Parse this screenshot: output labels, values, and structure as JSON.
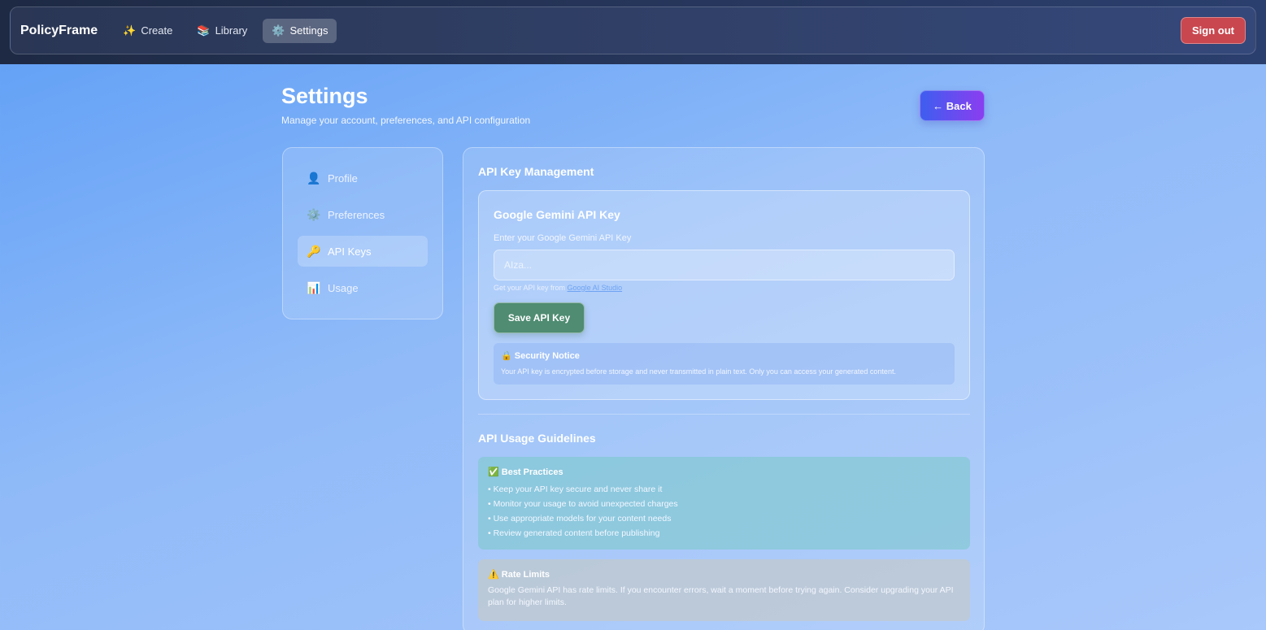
{
  "topbar": {
    "brand": "PolicyFrame",
    "nav": [
      {
        "icon": "✨",
        "icon_name": "sparkles-icon",
        "label": "Create"
      },
      {
        "icon": "📚",
        "icon_name": "books-icon",
        "label": "Library"
      },
      {
        "icon": "⚙️",
        "icon_name": "gear-icon",
        "label": "Settings"
      }
    ],
    "sign_out": "Sign out"
  },
  "header": {
    "title": "Settings",
    "subtitle": "Manage your account, preferences, and API configuration",
    "back_label": "← Back"
  },
  "sidebar": {
    "items": [
      {
        "icon": "👤",
        "icon_name": "user-icon",
        "label": "Profile"
      },
      {
        "icon": "⚙️",
        "icon_name": "gear-icon",
        "label": "Preferences"
      },
      {
        "icon": "🔑",
        "icon_name": "key-icon",
        "label": "API Keys"
      },
      {
        "icon": "📊",
        "icon_name": "bar-chart-icon",
        "label": "Usage"
      }
    ],
    "active": "API Keys"
  },
  "main": {
    "section_title": "API Key Management",
    "card": {
      "title": "Google Gemini API Key",
      "field_label": "Enter your Google Gemini API Key",
      "input_placeholder": "AIza...",
      "input_value": "",
      "hint_prefix": "Get your API key from ",
      "hint_link": "Google AI Studio",
      "save_label": "Save API Key",
      "notice_title": "🔒 Security Notice",
      "notice_text": "Your API key is encrypted before storage and never transmitted in plain text. Only you can access your generated content."
    },
    "guidelines_title": "API Usage Guidelines",
    "best_practices": {
      "title": "✅ Best Practices",
      "items": [
        "• Keep your API key secure and never share it",
        "• Monitor your usage to avoid unexpected charges",
        "• Use appropriate models for your content needs",
        "• Review generated content before publishing"
      ]
    },
    "rate_limits": {
      "title": "⚠️ Rate Limits",
      "text": "Google Gemini API has rate limits. If you encounter errors, wait a moment before trying again. Consider upgrading your API plan for higher limits."
    }
  },
  "colors": {
    "signout": "#c9474f",
    "save_button": "#4f8c72",
    "back_gradient_start": "#3e5ef0",
    "back_gradient_end": "#8a3ef0"
  }
}
